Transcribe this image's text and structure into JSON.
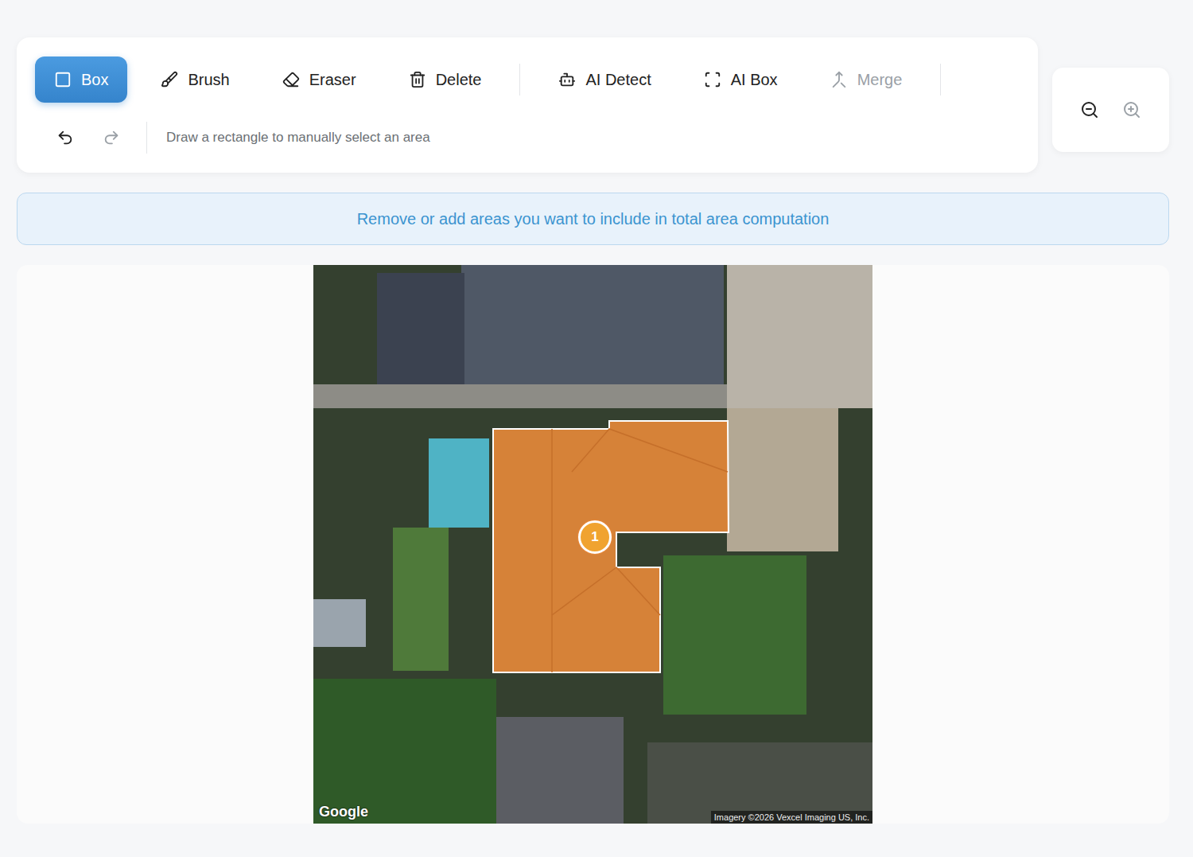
{
  "toolbar": {
    "tools": [
      {
        "kind": "box",
        "label": "Box",
        "selected": true,
        "disabled": false
      },
      {
        "kind": "brush",
        "label": "Brush",
        "selected": false,
        "disabled": false
      },
      {
        "kind": "eraser",
        "label": "Eraser",
        "selected": false,
        "disabled": false
      },
      {
        "kind": "delete",
        "label": "Delete",
        "selected": false,
        "disabled": false
      },
      {
        "kind": "ai-detect",
        "label": "AI Detect",
        "selected": false,
        "disabled": false
      },
      {
        "kind": "ai-box",
        "label": "AI Box",
        "selected": false,
        "disabled": false
      },
      {
        "kind": "merge",
        "label": "Merge",
        "selected": false,
        "disabled": true
      }
    ],
    "history": [
      {
        "kind": "undo",
        "disabled": false
      },
      {
        "kind": "redo",
        "disabled": true
      }
    ],
    "hint": "Draw a rectangle to manually select an area"
  },
  "zoom": [
    {
      "kind": "out",
      "disabled": false
    },
    {
      "kind": "in",
      "disabled": true
    }
  ],
  "banner": "Remove or add areas you want to include in total area computation",
  "map": {
    "regions": [
      {
        "label": "1",
        "selected": true,
        "color": "#e8893a"
      }
    ],
    "logo": "Google",
    "attribution": "Imagery ©2026 Vexcel Imaging US, Inc."
  }
}
